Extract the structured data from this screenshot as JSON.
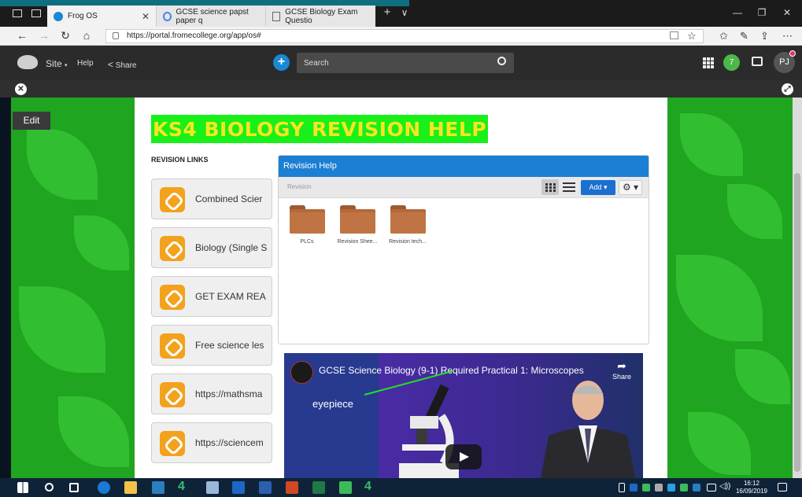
{
  "browser": {
    "tabs": [
      {
        "label": "Frog OS",
        "active": true
      },
      {
        "label": "GCSE science papst paper q",
        "active": false
      },
      {
        "label": "GCSE Biology Exam Questio",
        "active": false
      }
    ],
    "url": "https://portal.fromecollege.org/app/os#",
    "new_tab": "+",
    "tab_list": "∨"
  },
  "frog": {
    "site_label": "Site",
    "help_label": "Help",
    "share_label": "Share",
    "search_placeholder": "Search",
    "notification_count": "7",
    "user_initials": "PJ"
  },
  "page": {
    "edit_label": "Edit",
    "title": "KS4 BIOLOGY REVISION HELP",
    "revision_links_label": "REVISION LINKS",
    "links": [
      "Combined Scier",
      "Biology (Single S",
      "GET EXAM REA",
      "Free science les",
      "https://mathsma",
      "https://sciencem"
    ]
  },
  "panel": {
    "title": "Revision Help",
    "breadcrumb": "Revision",
    "add_label": "Add ▾",
    "settings_label": "⚙ ▾",
    "folders": [
      "PLCs",
      "Revision Shee...",
      "Revision tech..."
    ]
  },
  "video": {
    "title": "GCSE Science Biology (9-1) Required Practical 1: Microscopes",
    "share_label": "Share",
    "annotation": "eyepiece"
  },
  "taskbar": {
    "time": "16:12",
    "date": "16/09/2019"
  },
  "colors": {
    "page_background": "#1fa51f",
    "title_highlight": "#19f019",
    "title_text": "#f5e622",
    "panel_header": "#1b7fd4",
    "link_icon": "#f2a21c"
  }
}
